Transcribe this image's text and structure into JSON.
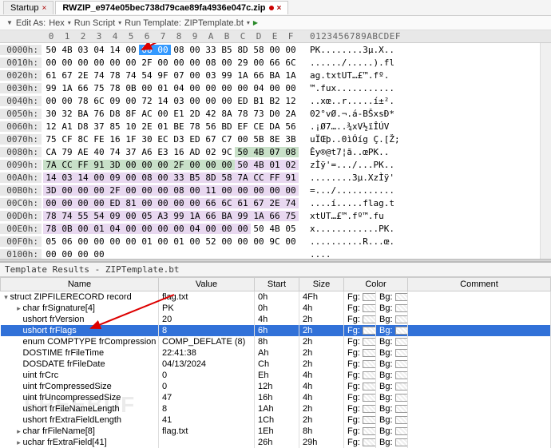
{
  "tabs": {
    "startup": "Startup",
    "file": "RWZIP_e974e05bec738d79cae89fa4936e047c.zip"
  },
  "toolbar": {
    "editAs": "Edit As:",
    "mode": "Hex",
    "runScript": "Run Script",
    "runTemplate": "Run Template:",
    "template": "ZIPTemplate.bt"
  },
  "hexHeader": {
    "cols": [
      "0",
      "1",
      "2",
      "3",
      "4",
      "5",
      "6",
      "7",
      "8",
      "9",
      "A",
      "B",
      "C",
      "D",
      "E",
      "F"
    ],
    "asciiLabel": "0123456789ABCDEF"
  },
  "hexRows": [
    {
      "off": "0000h:",
      "b": [
        "50",
        "4B",
        "03",
        "04",
        "14",
        "00",
        "08",
        "00",
        "08",
        "00",
        "33",
        "B5",
        "8D",
        "58",
        "00",
        "00"
      ],
      "hl": {
        "6": "sel",
        "7": "sel"
      },
      "a": "PK........3µ.X.."
    },
    {
      "off": "0010h:",
      "b": [
        "00",
        "00",
        "00",
        "00",
        "00",
        "00",
        "2F",
        "00",
        "00",
        "00",
        "08",
        "00",
        "29",
        "00",
        "66",
        "6C"
      ],
      "a": "....../.....).fl"
    },
    {
      "off": "0020h:",
      "b": [
        "61",
        "67",
        "2E",
        "74",
        "78",
        "74",
        "54",
        "9F",
        "07",
        "00",
        "03",
        "99",
        "1A",
        "66",
        "BA",
        "1A"
      ],
      "a": "ag.txtUT…£™.fº."
    },
    {
      "off": "0030h:",
      "b": [
        "99",
        "1A",
        "66",
        "75",
        "78",
        "0B",
        "00",
        "01",
        "04",
        "00",
        "00",
        "00",
        "00",
        "04",
        "00",
        "00"
      ],
      "a": "™.fux..........."
    },
    {
      "off": "0040h:",
      "b": [
        "00",
        "00",
        "78",
        "6C",
        "09",
        "00",
        "72",
        "14",
        "03",
        "00",
        "00",
        "00",
        "ED",
        "B1",
        "B2",
        "12"
      ],
      "a": "..xœ..r.....í±²."
    },
    {
      "off": "0050h:",
      "b": [
        "30",
        "32",
        "BA",
        "76",
        "D8",
        "8F",
        "AC",
        "00",
        "E1",
        "2D",
        "42",
        "8A",
        "78",
        "73",
        "D0",
        "2A"
      ],
      "a": "02°vØ.¬.á-BŠxsÐ*"
    },
    {
      "off": "0060h:",
      "b": [
        "12",
        "A1",
        "D8",
        "37",
        "85",
        "10",
        "2E",
        "01",
        "BE",
        "78",
        "56",
        "BD",
        "EF",
        "CE",
        "DA",
        "56"
      ],
      "a": ".¡Ø7…..¾xV½ïÎÚV"
    },
    {
      "off": "0070h:",
      "b": [
        "75",
        "CF",
        "8C",
        "FE",
        "16",
        "1F",
        "30",
        "EC",
        "D3",
        "ED",
        "67",
        "C7",
        "00",
        "5B",
        "8E",
        "3B"
      ],
      "a": "uÏŒþ..0ìÓíg Ç.[Ž;"
    },
    {
      "off": "0080h:",
      "b": [
        "CA",
        "79",
        "AE",
        "40",
        "74",
        "37",
        "A6",
        "E3",
        "16",
        "AD",
        "02",
        "9C",
        "50",
        "4B",
        "07",
        "08"
      ],
      "hl": {
        "12": "hl2",
        "13": "hl2",
        "14": "hl2",
        "15": "hl2"
      },
      "a": "Êy®@t7¦ã.­.œPK.."
    },
    {
      "off": "0090h:",
      "b": [
        "7A",
        "CC",
        "FF",
        "91",
        "3D",
        "00",
        "00",
        "00",
        "2F",
        "00",
        "00",
        "00",
        "50",
        "4B",
        "01",
        "02"
      ],
      "hl": {
        "0": "hl2",
        "1": "hl2",
        "2": "hl2",
        "3": "hl2",
        "4": "hl2",
        "5": "hl2",
        "6": "hl2",
        "7": "hl2",
        "8": "hl2",
        "9": "hl2",
        "10": "hl2",
        "11": "hl2",
        "12": "hl3",
        "13": "hl3",
        "14": "hl3",
        "15": "hl3"
      },
      "a": "zÌÿ'=.../...PK.."
    },
    {
      "off": "00A0h:",
      "b": [
        "14",
        "03",
        "14",
        "00",
        "09",
        "00",
        "08",
        "00",
        "33",
        "B5",
        "8D",
        "58",
        "7A",
        "CC",
        "FF",
        "91"
      ],
      "hl": {
        "0": "hl3",
        "1": "hl3",
        "2": "hl3",
        "3": "hl3",
        "4": "hl3",
        "5": "hl3",
        "6": "hl3",
        "7": "hl3",
        "8": "hl3",
        "9": "hl3",
        "10": "hl3",
        "11": "hl3",
        "12": "hl3",
        "13": "hl3",
        "14": "hl3",
        "15": "hl3"
      },
      "a": "........3µ.XzÌÿ'"
    },
    {
      "off": "00B0h:",
      "b": [
        "3D",
        "00",
        "00",
        "00",
        "2F",
        "00",
        "00",
        "00",
        "08",
        "00",
        "11",
        "00",
        "00",
        "00",
        "00",
        "00"
      ],
      "hl": {
        "0": "hl3",
        "1": "hl3",
        "2": "hl3",
        "3": "hl3",
        "4": "hl3",
        "5": "hl3",
        "6": "hl3",
        "7": "hl3",
        "8": "hl3",
        "9": "hl3",
        "10": "hl3",
        "11": "hl3",
        "12": "hl3",
        "13": "hl3",
        "14": "hl3",
        "15": "hl3"
      },
      "a": "=.../..........."
    },
    {
      "off": "00C0h:",
      "b": [
        "00",
        "00",
        "00",
        "00",
        "ED",
        "81",
        "00",
        "00",
        "00",
        "00",
        "66",
        "6C",
        "61",
        "67",
        "2E",
        "74"
      ],
      "hl": {
        "0": "hl3",
        "1": "hl3",
        "2": "hl3",
        "3": "hl3",
        "4": "hl3",
        "5": "hl3",
        "6": "hl3",
        "7": "hl3",
        "8": "hl3",
        "9": "hl3",
        "10": "hl3",
        "11": "hl3",
        "12": "hl3",
        "13": "hl3",
        "14": "hl3",
        "15": "hl3"
      },
      "a": "....í.....flag.t"
    },
    {
      "off": "00D0h:",
      "b": [
        "78",
        "74",
        "55",
        "54",
        "09",
        "00",
        "05",
        "A3",
        "99",
        "1A",
        "66",
        "BA",
        "99",
        "1A",
        "66",
        "75"
      ],
      "hl": {
        "0": "hl3",
        "1": "hl3",
        "2": "hl3",
        "3": "hl3",
        "4": "hl3",
        "5": "hl3",
        "6": "hl3",
        "7": "hl3",
        "8": "hl3",
        "9": "hl3",
        "10": "hl3",
        "11": "hl3",
        "12": "hl3",
        "13": "hl3",
        "14": "hl3",
        "15": "hl3"
      },
      "a": "xtUT…£™.fº™.fu"
    },
    {
      "off": "00E0h:",
      "b": [
        "78",
        "0B",
        "00",
        "01",
        "04",
        "00",
        "00",
        "00",
        "00",
        "04",
        "00",
        "00",
        "00",
        "50",
        "4B",
        "05"
      ],
      "hl": {
        "0": "hl3",
        "1": "hl3",
        "2": "hl3",
        "3": "hl3",
        "4": "hl3",
        "5": "hl3",
        "6": "hl3",
        "7": "hl3",
        "8": "hl3",
        "9": "hl3",
        "10": "hl3",
        "11": "hl3",
        "12": "hl3"
      },
      "a": "x............PK."
    },
    {
      "off": "00F0h:",
      "b": [
        "05",
        "06",
        "00",
        "00",
        "00",
        "00",
        "01",
        "00",
        "01",
        "00",
        "52",
        "00",
        "00",
        "00",
        "9C",
        "00"
      ],
      "a": "..........R...œ."
    },
    {
      "off": "0100h:",
      "b": [
        "00",
        "00",
        "00",
        "00",
        "",
        "",
        "",
        "",
        "",
        "",
        "",
        "",
        "",
        "",
        "",
        ""
      ],
      "a": "...."
    }
  ],
  "resultsTitle": "Template Results - ZIPTemplate.bt",
  "gridHeaders": {
    "name": "Name",
    "value": "Value",
    "start": "Start",
    "size": "Size",
    "color": "Color",
    "comment": "Comment"
  },
  "gridRows": [
    {
      "ind": 0,
      "tw": "▾",
      "name": "struct ZIPFILERECORD record",
      "value": "flag.txt",
      "start": "0h",
      "size": "4Fh",
      "fg": "Fg:",
      "bg": "Bg:",
      "sel": false
    },
    {
      "ind": 1,
      "tw": "▸",
      "name": "char frSignature[4]",
      "value": "PK",
      "start": "0h",
      "size": "4h",
      "fg": "Fg:",
      "bg": "Bg:",
      "sel": false
    },
    {
      "ind": 1,
      "tw": "",
      "name": "ushort frVersion",
      "value": "20",
      "start": "4h",
      "size": "2h",
      "fg": "Fg:",
      "bg": "Bg:",
      "sel": false
    },
    {
      "ind": 1,
      "tw": "",
      "name": "ushort frFlags",
      "value": "8",
      "start": "6h",
      "size": "2h",
      "fg": "Fg:",
      "bg": "Bg:",
      "sel": true
    },
    {
      "ind": 1,
      "tw": "",
      "name": "enum COMPTYPE frCompression",
      "value": "COMP_DEFLATE (8)",
      "start": "8h",
      "size": "2h",
      "fg": "Fg:",
      "bg": "Bg:",
      "sel": false
    },
    {
      "ind": 1,
      "tw": "",
      "name": "DOSTIME frFileTime",
      "value": "22:41:38",
      "start": "Ah",
      "size": "2h",
      "fg": "Fg:",
      "bg": "Bg:",
      "sel": false
    },
    {
      "ind": 1,
      "tw": "",
      "name": "DOSDATE frFileDate",
      "value": "04/13/2024",
      "start": "Ch",
      "size": "2h",
      "fg": "Fg:",
      "bg": "Bg:",
      "sel": false
    },
    {
      "ind": 1,
      "tw": "",
      "name": "uint frCrc",
      "value": "0",
      "start": "Eh",
      "size": "4h",
      "fg": "Fg:",
      "bg": "Bg:",
      "sel": false
    },
    {
      "ind": 1,
      "tw": "",
      "name": "uint frCompressedSize",
      "value": "0",
      "start": "12h",
      "size": "4h",
      "fg": "Fg:",
      "bg": "Bg:",
      "sel": false
    },
    {
      "ind": 1,
      "tw": "",
      "name": "uint frUncompressedSize",
      "value": "47",
      "start": "16h",
      "size": "4h",
      "fg": "Fg:",
      "bg": "Bg:",
      "sel": false
    },
    {
      "ind": 1,
      "tw": "",
      "name": "ushort frFileNameLength",
      "value": "8",
      "start": "1Ah",
      "size": "2h",
      "fg": "Fg:",
      "bg": "Bg:",
      "sel": false
    },
    {
      "ind": 1,
      "tw": "",
      "name": "ushort frExtraFieldLength",
      "value": "41",
      "start": "1Ch",
      "size": "2h",
      "fg": "Fg:",
      "bg": "Bg:",
      "sel": false
    },
    {
      "ind": 1,
      "tw": "▸",
      "name": "char frFileName[8]",
      "value": "flag.txt",
      "start": "1Eh",
      "size": "8h",
      "fg": "Fg:",
      "bg": "Bg:",
      "sel": false
    },
    {
      "ind": 1,
      "tw": "▸",
      "name": "uchar frExtraField[41]",
      "value": "",
      "start": "26h",
      "size": "29h",
      "fg": "Fg:",
      "bg": "Bg:",
      "sel": false
    }
  ]
}
